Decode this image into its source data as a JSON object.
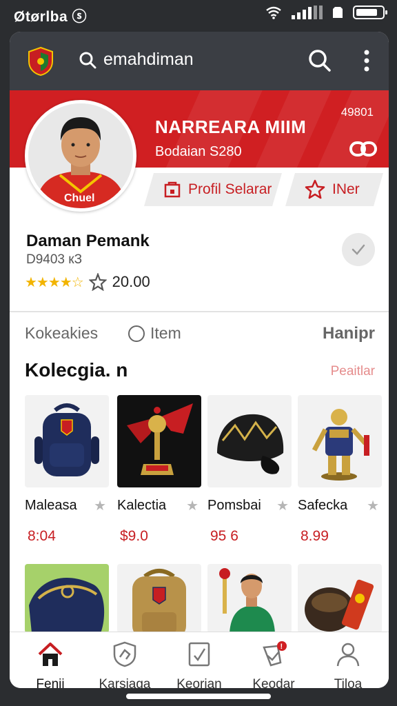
{
  "status_bar": {
    "carrier": "Øtørlba ⓢ"
  },
  "topbar": {
    "search_text": "emahdiman",
    "logo": "shield-logo",
    "search_icon": "search-icon",
    "more_icon": "more-vertical-icon"
  },
  "banner": {
    "title": "NARREARA MIIM",
    "subtitle": "Bodaian S280",
    "count": "49801",
    "link_icon": "link-icon",
    "color": "#d01f22"
  },
  "actions": {
    "profile_button": "Profil Selarar",
    "follow_button": "INer"
  },
  "profile": {
    "name": "Daman Pemank",
    "id_text": "D9403 кЗ",
    "stars": "★★★★☆",
    "rating_value": "20.00"
  },
  "tabs": {
    "tab1": "Kokeakies",
    "tab2": "Item",
    "tab3": "Hanipr"
  },
  "section": {
    "title": "Kolecgia. n",
    "link": "Peaitlar"
  },
  "items": [
    {
      "name": "Maleasa",
      "price": "8:04",
      "image": "backpack"
    },
    {
      "name": "Kalectia",
      "price": "$9.0",
      "image": "trophy"
    },
    {
      "name": "Pomsbai",
      "price": "95 6",
      "image": "cap"
    },
    {
      "name": "Safecka",
      "price": "8.99",
      "image": "figurine"
    }
  ],
  "row2_items": [
    "scarf",
    "backpack-tan",
    "player-figure",
    "boots"
  ],
  "bottom_nav": [
    {
      "label": "Fenji",
      "icon": "home-icon"
    },
    {
      "label": "Karsiaga",
      "icon": "shield-icon"
    },
    {
      "label": "Keorian",
      "icon": "document-icon"
    },
    {
      "label": "Keodar",
      "icon": "notification-icon",
      "badge": "!"
    },
    {
      "label": "Tiloa",
      "icon": "profile-icon"
    }
  ],
  "colors": {
    "accent": "#c71e22",
    "header": "#3b3e44",
    "star": "#f2b400"
  }
}
